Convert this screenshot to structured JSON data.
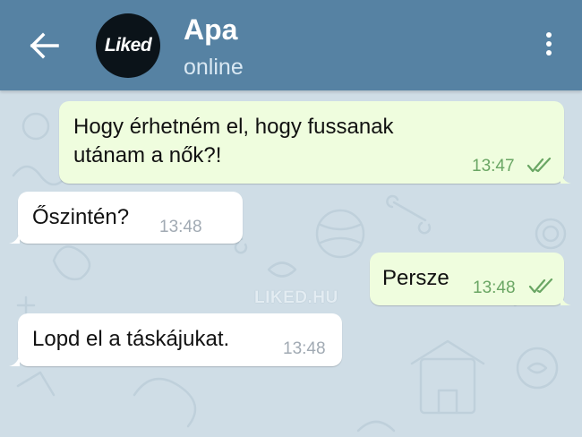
{
  "header": {
    "back_icon": "arrow-left-icon",
    "avatar_text": "Liked",
    "contact_name": "Apa",
    "status": "online",
    "menu_icon": "more-vertical-icon"
  },
  "messages": [
    {
      "direction": "outgoing",
      "line1": "Hogy érhetném el, hogy fussanak",
      "line2": "utánam a nők?!",
      "time": "13:47",
      "read": true
    },
    {
      "direction": "incoming",
      "text": "Őszintén?",
      "time": "13:48"
    },
    {
      "direction": "outgoing",
      "text": "Persze",
      "time": "13:48",
      "read": true
    },
    {
      "direction": "incoming",
      "text": "Lopd el a táskájukat.",
      "time": "13:48"
    }
  ],
  "watermark": "LIKED.HU",
  "colors": {
    "header": "#5682a3",
    "chat_background": "#cfdde6",
    "outgoing_bubble": "#effdde",
    "incoming_bubble": "#ffffff",
    "outgoing_time": "#6aa664"
  }
}
